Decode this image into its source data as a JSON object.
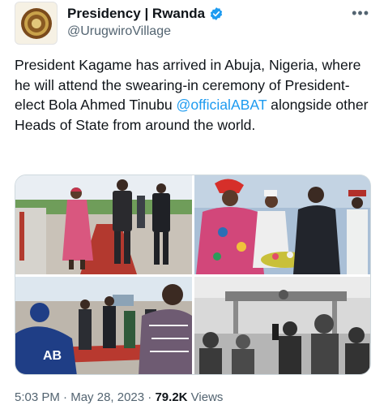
{
  "account": {
    "name": "Presidency | Rwanda",
    "handle": "@UrugwiroVillage",
    "verified_color": "#1d9bf0"
  },
  "tweet": {
    "text_before": "President Kagame has arrived in Abuja, Nigeria, where he will attend the swearing-in ceremony of President-elect Bola Ahmed Tinubu ",
    "mention": "@officialABAT",
    "text_after": " alongside other Heads of State from around the world."
  },
  "media": {
    "count": 4,
    "photos": [
      "arrival-walk-photo",
      "greeting-photo",
      "airport-crowd-photo",
      "guard-of-honour-photo"
    ]
  },
  "meta": {
    "time": "5:03 PM",
    "separator": "·",
    "date": "May 28, 2023",
    "views_count": "79.2K",
    "views_label": "Views"
  },
  "more_icon": "more-horizontal-icon"
}
